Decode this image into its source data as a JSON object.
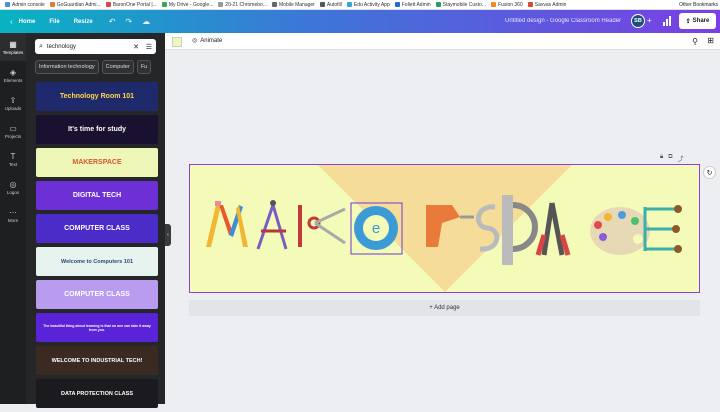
{
  "bookmarks": [
    "Admin console",
    "GoGuardian Admi...",
    "BaronOne Portal |...",
    "My Drive - Google...",
    "20-21 Chromebo...",
    "Mobile Manager",
    "Autofill",
    "Edu Activity App",
    "Follett Admin",
    "Staymobile Custo...",
    "Fusion 360",
    "Savvas Admin"
  ],
  "bookmarks_right": "Other Bookmarks",
  "topbar": {
    "home": "Home",
    "file": "File",
    "resize": "Resize",
    "title": "Untitled design - Google Classroom Header",
    "avatar": "SB",
    "share": "Share"
  },
  "rail": [
    {
      "label": "Templates",
      "icon": "▦"
    },
    {
      "label": "Elements",
      "icon": "◈"
    },
    {
      "label": "Uploads",
      "icon": "⇪"
    },
    {
      "label": "Projects",
      "icon": "▭"
    },
    {
      "label": "Text",
      "icon": "T"
    },
    {
      "label": "Logos",
      "icon": "◎"
    },
    {
      "label": "More",
      "icon": "⋯"
    }
  ],
  "search": {
    "value": "technology"
  },
  "chips": [
    "Information technology",
    "Computer",
    "Fu"
  ],
  "thumbnails": [
    {
      "text": "Technology Room 101",
      "bg": "#1e2a6b",
      "fg": "#ffd84a"
    },
    {
      "text": "It's time for study",
      "bg": "#1a1030",
      "fg": "#ffffff"
    },
    {
      "text": "MAKERSPACE",
      "bg": "#eef7b8",
      "fg": "#d9552f"
    },
    {
      "text": "DIGITAL TECH",
      "bg": "#6d2fd6",
      "fg": "#ffffff"
    },
    {
      "text": "COMPUTER CLASS",
      "bg": "#4b2cc8",
      "fg": "#ffffff"
    },
    {
      "text": "Welcome to Computers 101",
      "bg": "#e6f3ee",
      "fg": "#2a4a7a"
    },
    {
      "text": "COMPUTER CLASS",
      "bg": "#b99cf0",
      "fg": "#ffffff"
    },
    {
      "text": "The beautiful thing about learning is that no one can take it away from you.",
      "bg": "#5a23d8",
      "fg": "#ffffff"
    },
    {
      "text": "WELCOME TO INDUSTRIAL TECH!",
      "bg": "#3a2a22",
      "fg": "#ffffff"
    },
    {
      "text": "DATA PROTECTION CLASS",
      "bg": "#1b1b1f",
      "fg": "#ffffff"
    }
  ],
  "toolbar": {
    "animate": "Animate"
  },
  "add_page": "+ Add page",
  "colors": {
    "canvas_bg": "#f4fab7",
    "selection": "#8b3fdb",
    "triangle": "#f5dd99"
  }
}
